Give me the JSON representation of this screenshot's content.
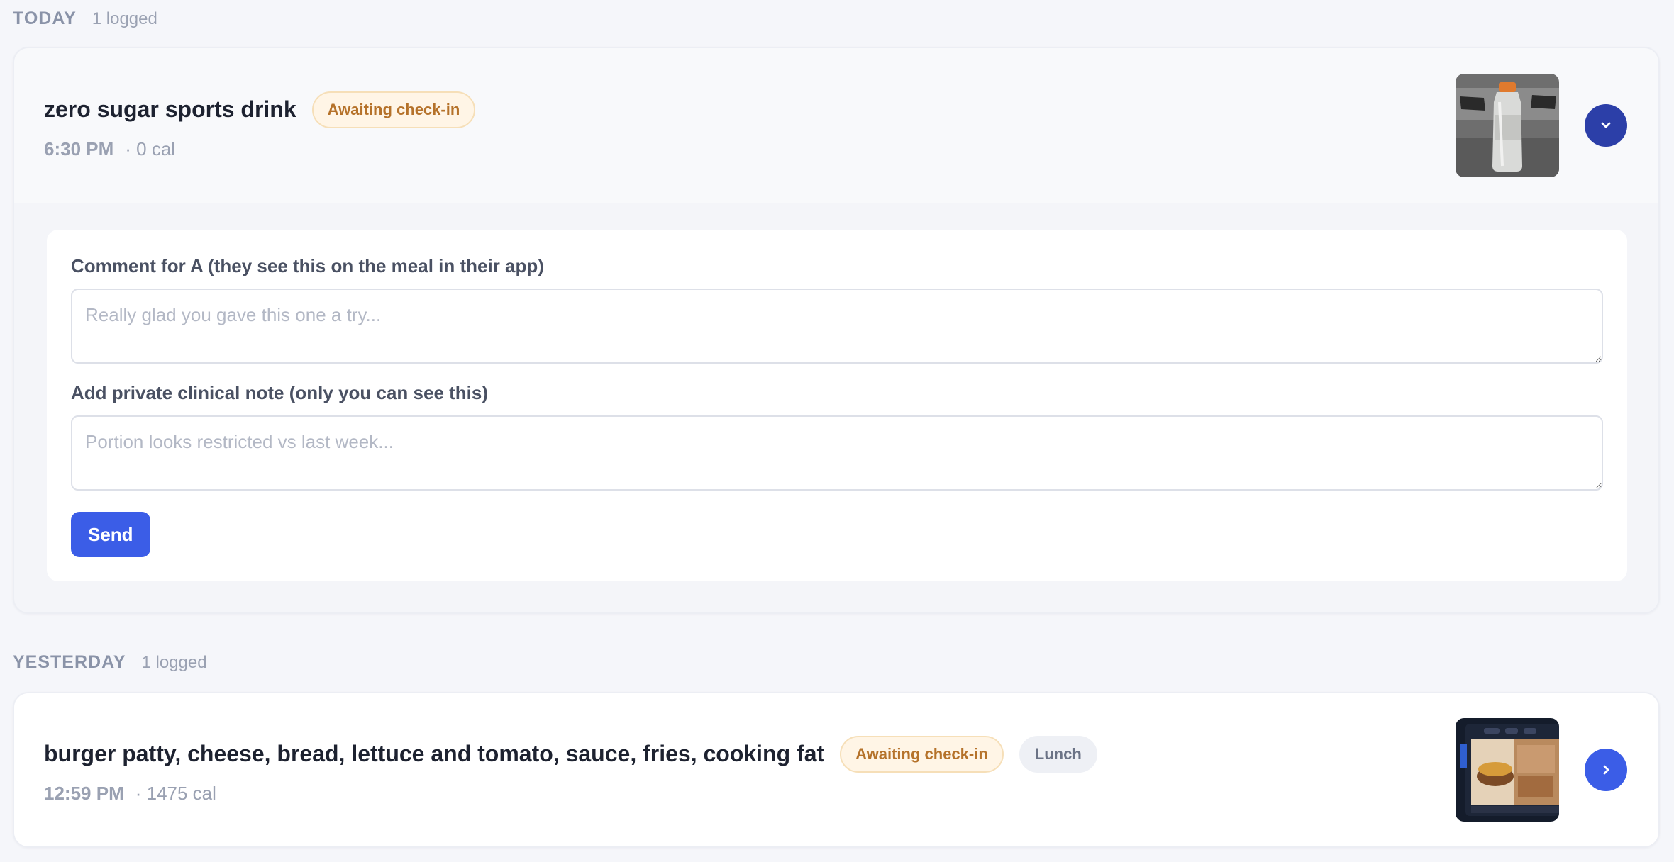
{
  "sections": {
    "today": {
      "title": "TODAY",
      "count": "1 logged",
      "meal": {
        "name": "zero sugar sports drink",
        "status": "Awaiting check-in",
        "time": "6:30 PM",
        "calories": "· 0 cal",
        "thumbnail": "sports-drink-bottle-photo",
        "toggle_icon": "chevron-down-icon",
        "expanded": true
      },
      "comment_form": {
        "comment_label": "Comment for A (they see this on the meal in their app)",
        "comment_placeholder": "Really glad you gave this one a try...",
        "comment_value": "",
        "note_label": "Add private clinical note (only you can see this)",
        "note_placeholder": "Portion looks restricted vs last week...",
        "note_value": "",
        "send_label": "Send"
      }
    },
    "yesterday": {
      "title": "YESTERDAY",
      "count": "1 logged",
      "meal": {
        "name": "burger patty, cheese, bread, lettuce and tomato, sauce, fries, cooking fat",
        "status": "Awaiting check-in",
        "tag": "Lunch",
        "time": "12:59 PM",
        "calories": "· 1475 cal",
        "thumbnail": "burger-meal-photo",
        "toggle_icon": "chevron-right-icon",
        "expanded": false
      }
    }
  },
  "colors": {
    "background": "#f5f6fa",
    "accent": "#3b5de7",
    "accent_dark": "#2c3fa8",
    "awaiting_bg": "#fff5e6",
    "awaiting_text": "#b5722a",
    "muted_text": "#9aa1b2"
  }
}
